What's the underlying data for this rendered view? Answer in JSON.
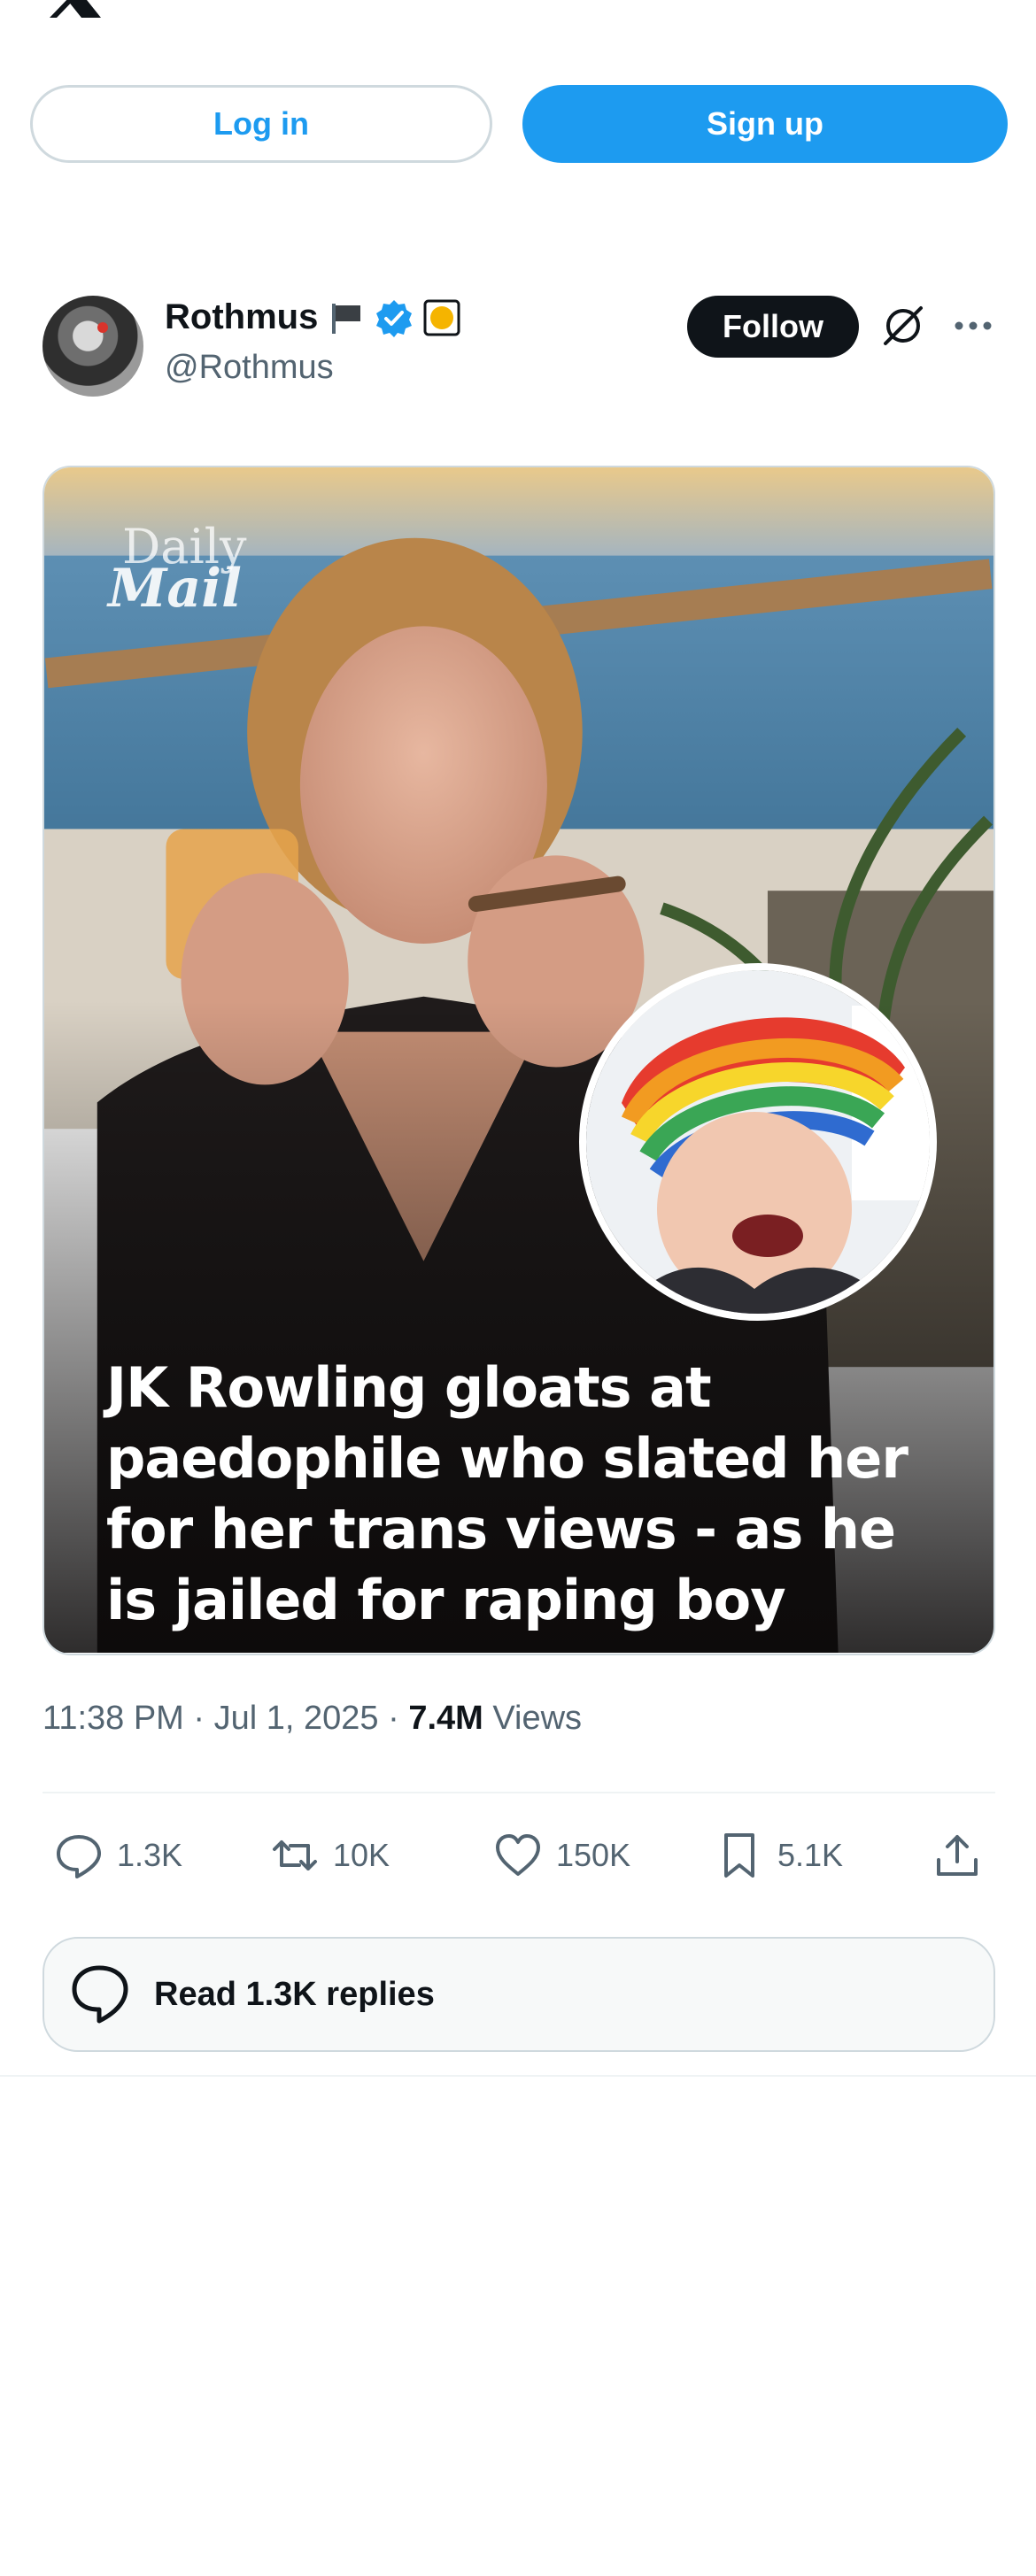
{
  "header": {
    "logo_icon": "x-logo-icon",
    "login_label": "Log in",
    "signup_label": "Sign up"
  },
  "post": {
    "author": {
      "display_name": "Rothmus",
      "handle": "@Rothmus",
      "badges": [
        "flag-icon",
        "verified-icon",
        "yellow-badge-icon"
      ]
    },
    "follow_label": "Follow",
    "media": {
      "watermark_line1": "Daily",
      "watermark_line2": "Mail",
      "headline": "JK Rowling gloats at paedophile who slated her for her trans views - as he is jailed for raping boy"
    },
    "time": "11:38 PM",
    "date": "Jul 1, 2025",
    "separator": "·",
    "views_count": "7.4M",
    "views_label": "Views",
    "actions": {
      "replies": "1.3K",
      "reposts": "10K",
      "likes": "150K",
      "bookmarks": "5.1K"
    },
    "read_replies_label": "Read 1.3K replies"
  },
  "colors": {
    "accent": "#1d9bf0",
    "text": "#0f1419",
    "muted": "#536471",
    "border": "#cfd9de"
  }
}
